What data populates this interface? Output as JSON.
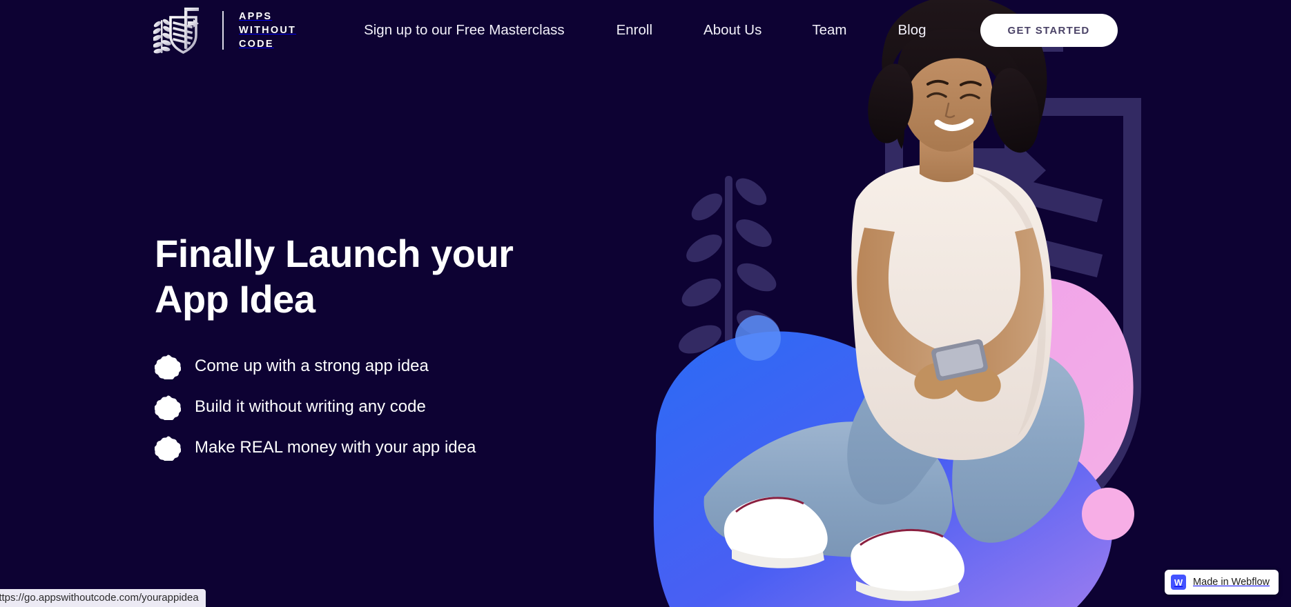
{
  "site": {
    "background_color": "#0d0233",
    "accent_white": "#ffffff"
  },
  "navbar": {
    "logo": {
      "icon": "shield-arrow-laurel-logo-icon",
      "wordmark_line1": "APPS",
      "wordmark_line2": "WITHOUT",
      "wordmark_line3": "CODE"
    },
    "links": [
      {
        "label": "Sign up to our Free Masterclass"
      },
      {
        "label": "Enroll"
      },
      {
        "label": "About Us"
      },
      {
        "label": "Team"
      },
      {
        "label": "Blog"
      }
    ],
    "cta": {
      "label": "GET STARTED",
      "background_color": "#ffffff",
      "text_color": "#4a4266"
    }
  },
  "hero": {
    "title_line1": "Finally Launch your",
    "title_line2": "App Idea",
    "bullets": [
      {
        "icon": "scalloped-badge-icon",
        "text": "Come up with a strong app idea"
      },
      {
        "icon": "scalloped-badge-icon",
        "text": "Build it without writing any code"
      },
      {
        "icon": "scalloped-badge-icon",
        "text": "Make REAL money with your app idea"
      }
    ],
    "artwork": {
      "description": "woman-sitting-with-phone-photo",
      "watermark_icon": "shield-arrow-laurel-watermark-icon",
      "watermark_color": "#332a63",
      "blob_blue_start": "#2b6bf5",
      "blob_blue_end": "#7d6cf0",
      "blob_pink": "#f2a4ea",
      "dot_pink": "#f7aee6",
      "dot_blue": "#5b8df8"
    }
  },
  "status_bar": {
    "url": "https://go.appswithoutcode.com/yourappidea"
  },
  "webflow_badge": {
    "icon_letter": "W",
    "label": "Made in Webflow",
    "icon_color": "#4353ff"
  }
}
